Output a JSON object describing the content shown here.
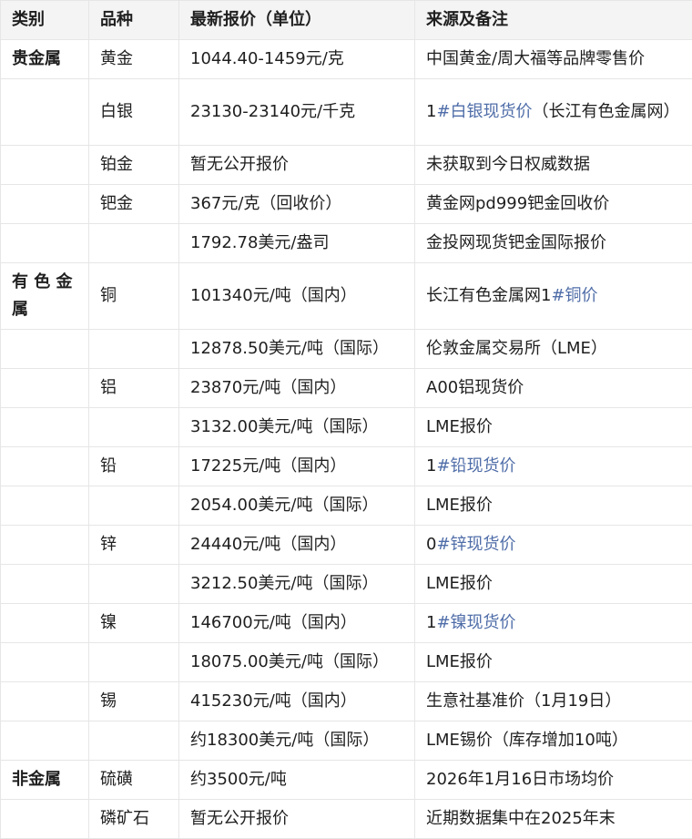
{
  "headers": [
    "类别",
    "品种",
    "最新报价（单位）",
    "来源及备注"
  ],
  "rows": [
    {
      "category": "贵金属",
      "variety": "黄金",
      "price": "1044.40-1459元/克",
      "source": [
        {
          "t": "中国黄金/周大福等品牌零售价"
        }
      ]
    },
    {
      "category": "",
      "variety": "白银",
      "price": "23130-23140元/千克",
      "source": [
        {
          "t": "1"
        },
        {
          "t": "#白银现货价",
          "ref": true
        },
        {
          "t": "（长江有色金属网）"
        }
      ],
      "tall": true
    },
    {
      "category": "",
      "variety": "铂金",
      "price": "暂无公开报价",
      "source": [
        {
          "t": "未获取到今日权威数据"
        }
      ]
    },
    {
      "category": "",
      "variety": "钯金",
      "price": "367元/克（回收价）",
      "source": [
        {
          "t": "黄金网pd999钯金回收价"
        }
      ]
    },
    {
      "category": "",
      "variety": "",
      "price": "1792.78美元/盎司",
      "source": [
        {
          "t": "金投网现货钯金国际报价"
        }
      ]
    },
    {
      "category": "有 色 金 属",
      "variety": "铜",
      "price": "101340元/吨（国内）",
      "source": [
        {
          "t": "长江有色金属网1"
        },
        {
          "t": "#铜价",
          "ref": true
        }
      ],
      "tall": true
    },
    {
      "category": "",
      "variety": "",
      "price": "12878.50美元/吨（国际）",
      "source": [
        {
          "t": "伦敦金属交易所（LME）"
        }
      ]
    },
    {
      "category": "",
      "variety": "铝",
      "price": "23870元/吨（国内）",
      "source": [
        {
          "t": "A00铝现货价"
        }
      ]
    },
    {
      "category": "",
      "variety": "",
      "price": "3132.00美元/吨（国际）",
      "source": [
        {
          "t": "LME报价"
        }
      ]
    },
    {
      "category": "",
      "variety": "铅",
      "price": "17225元/吨（国内）",
      "source": [
        {
          "t": "1"
        },
        {
          "t": "#铅现货价",
          "ref": true
        }
      ]
    },
    {
      "category": "",
      "variety": "",
      "price": "2054.00美元/吨（国际）",
      "source": [
        {
          "t": "LME报价"
        }
      ]
    },
    {
      "category": "",
      "variety": "锌",
      "price": "24440元/吨（国内）",
      "source": [
        {
          "t": "0"
        },
        {
          "t": "#锌现货价",
          "ref": true
        }
      ]
    },
    {
      "category": "",
      "variety": "",
      "price": "3212.50美元/吨（国际）",
      "source": [
        {
          "t": "LME报价"
        }
      ]
    },
    {
      "category": "",
      "variety": "镍",
      "price": "146700元/吨（国内）",
      "source": [
        {
          "t": "1"
        },
        {
          "t": "#镍现货价",
          "ref": true
        }
      ]
    },
    {
      "category": "",
      "variety": "",
      "price": "18075.00美元/吨（国际）",
      "source": [
        {
          "t": "LME报价"
        }
      ]
    },
    {
      "category": "",
      "variety": "锡",
      "price": "415230元/吨（国内）",
      "source": [
        {
          "t": "生意社基准价（1月19日）"
        }
      ]
    },
    {
      "category": "",
      "variety": "",
      "price": "约18300美元/吨（国际）",
      "source": [
        {
          "t": "LME锡价（库存增加10吨）"
        }
      ]
    },
    {
      "category": "非金属",
      "variety": "硫磺",
      "price": "约3500元/吨",
      "source": [
        {
          "t": "2026年1月16日市场均价"
        }
      ]
    },
    {
      "category": "",
      "variety": "磷矿石",
      "price": "暂无公开报价",
      "source": [
        {
          "t": "近期数据集中在2025年末"
        }
      ]
    }
  ]
}
